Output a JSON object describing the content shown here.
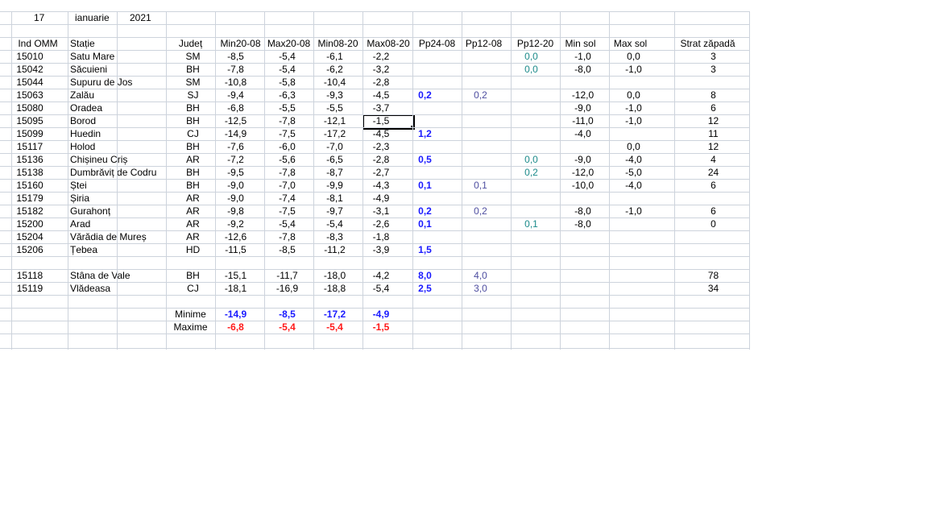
{
  "colors": {
    "blue_bold": "#1a1aff",
    "slate_blue": "#4e4ea0",
    "teal": "#1b8a8a",
    "red": "#ff1a1a",
    "grid": "#cdd3dc"
  },
  "date": {
    "day": "17",
    "month": "ianuarie",
    "year": "2021"
  },
  "headers": {
    "ind": "Ind OMM",
    "statie": "Stație",
    "judet": "Județ",
    "min2008": "Min20-08",
    "max2008": "Max20-08",
    "min0820": "Min08-20",
    "max0820": "Max08-20",
    "pp2408": "Pp24-08",
    "pp1208": "Pp12-08",
    "pp1220": "Pp12-20",
    "minsol": "Min sol",
    "maxsol": "Max sol",
    "strat": "Strat zăpadă"
  },
  "rows": [
    {
      "ind": "15010",
      "statie": "Satu Mare",
      "judet": "SM",
      "min2008": "-8,5",
      "max2008": "-5,4",
      "min0820": "-6,1",
      "max0820": "-2,2",
      "pp2408": "",
      "pp1208": "",
      "pp1220": "0,0",
      "minsol": "-1,0",
      "maxsol": "0,0",
      "strat": "3"
    },
    {
      "ind": "15042",
      "statie": "Săcuieni",
      "judet": "BH",
      "min2008": "-7,8",
      "max2008": "-5,4",
      "min0820": "-6,2",
      "max0820": "-3,2",
      "pp2408": "",
      "pp1208": "",
      "pp1220": "0,0",
      "minsol": "-8,0",
      "maxsol": "-1,0",
      "strat": "3"
    },
    {
      "ind": "15044",
      "statie": "Supuru de Jos",
      "judet": "SM",
      "min2008": "-10,8",
      "max2008": "-5,8",
      "min0820": "-10,4",
      "max0820": "-2,8",
      "pp2408": "",
      "pp1208": "",
      "pp1220": "",
      "minsol": "",
      "maxsol": "",
      "strat": ""
    },
    {
      "ind": "15063",
      "statie": "Zalău",
      "judet": "SJ",
      "min2008": "-9,4",
      "max2008": "-6,3",
      "min0820": "-9,3",
      "max0820": "-4,5",
      "pp2408": "0,2",
      "pp1208": "0,2",
      "pp1220": "",
      "minsol": "-12,0",
      "maxsol": "0,0",
      "strat": "8"
    },
    {
      "ind": "15080",
      "statie": "Oradea",
      "judet": "BH",
      "min2008": "-6,8",
      "max2008": "-5,5",
      "min0820": "-5,5",
      "max0820": "-3,7",
      "pp2408": "",
      "pp1208": "",
      "pp1220": "",
      "minsol": "-9,0",
      "maxsol": "-1,0",
      "strat": "6"
    },
    {
      "ind": "15095",
      "statie": "Borod",
      "judet": "BH",
      "min2008": "-12,5",
      "max2008": "-7,8",
      "min0820": "-12,1",
      "max0820": "-1,5",
      "pp2408": "",
      "pp1208": "",
      "pp1220": "",
      "minsol": "-11,0",
      "maxsol": "-1,0",
      "strat": "12"
    },
    {
      "ind": "15099",
      "statie": "Huedin",
      "judet": "CJ",
      "min2008": "-14,9",
      "max2008": "-7,5",
      "min0820": "-17,2",
      "max0820": "-4,5",
      "pp2408": "1,2",
      "pp1208": "",
      "pp1220": "",
      "minsol": "-4,0",
      "maxsol": "",
      "strat": "11"
    },
    {
      "ind": "15117",
      "statie": "Holod",
      "judet": "BH",
      "min2008": "-7,6",
      "max2008": "-6,0",
      "min0820": "-7,0",
      "max0820": "-2,3",
      "pp2408": "",
      "pp1208": "",
      "pp1220": "",
      "minsol": "",
      "maxsol": "0,0",
      "strat": "12"
    },
    {
      "ind": "15136",
      "statie": "Chișineu   Criș",
      "judet": "AR",
      "min2008": "-7,2",
      "max2008": "-5,6",
      "min0820": "-6,5",
      "max0820": "-2,8",
      "pp2408": "0,5",
      "pp1208": "",
      "pp1220": "0,0",
      "minsol": "-9,0",
      "maxsol": "-4,0",
      "strat": "4"
    },
    {
      "ind": "15138",
      "statie": "Dumbrăviț  de Codru",
      "judet": "BH",
      "min2008": "-9,5",
      "max2008": "-7,8",
      "min0820": "-8,7",
      "max0820": "-2,7",
      "pp2408": "",
      "pp1208": "",
      "pp1220": "0,2",
      "minsol": "-12,0",
      "maxsol": "-5,0",
      "strat": "24"
    },
    {
      "ind": "15160",
      "statie": "Ștei",
      "judet": "BH",
      "min2008": "-9,0",
      "max2008": "-7,0",
      "min0820": "-9,9",
      "max0820": "-4,3",
      "pp2408": "0,1",
      "pp1208": "0,1",
      "pp1220": "",
      "minsol": "-10,0",
      "maxsol": "-4,0",
      "strat": "6"
    },
    {
      "ind": "15179",
      "statie": "Șiria",
      "judet": "AR",
      "min2008": "-9,0",
      "max2008": "-7,4",
      "min0820": "-8,1",
      "max0820": "-4,9",
      "pp2408": "",
      "pp1208": "",
      "pp1220": "",
      "minsol": "",
      "maxsol": "",
      "strat": ""
    },
    {
      "ind": "15182",
      "statie": "Gurahonț",
      "judet": "AR",
      "min2008": "-9,8",
      "max2008": "-7,5",
      "min0820": "-9,7",
      "max0820": "-3,1",
      "pp2408": "0,2",
      "pp1208": "0,2",
      "pp1220": "",
      "minsol": "-8,0",
      "maxsol": "-1,0",
      "strat": "6"
    },
    {
      "ind": "15200",
      "statie": "Arad",
      "judet": "AR",
      "min2008": "-9,2",
      "max2008": "-5,4",
      "min0820": "-5,4",
      "max0820": "-2,6",
      "pp2408": "0,1",
      "pp1208": "",
      "pp1220": "0,1",
      "minsol": "-8,0",
      "maxsol": "",
      "strat": "0"
    },
    {
      "ind": "15204",
      "statie": "Vărădia de Mureș",
      "judet": "AR",
      "min2008": "-12,6",
      "max2008": "-7,8",
      "min0820": "-8,3",
      "max0820": "-1,8",
      "pp2408": "",
      "pp1208": "",
      "pp1220": "",
      "minsol": "",
      "maxsol": "",
      "strat": ""
    },
    {
      "ind": "15206",
      "statie": "Țebea",
      "judet": "HD",
      "min2008": "-11,5",
      "max2008": "-8,5",
      "min0820": "-11,2",
      "max0820": "-3,9",
      "pp2408": "1,5",
      "pp1208": "",
      "pp1220": "",
      "minsol": "",
      "maxsol": "",
      "strat": ""
    },
    null,
    {
      "ind": "15118",
      "statie": "Stâna de Vale",
      "judet": "BH",
      "min2008": "-15,1",
      "max2008": "-11,7",
      "min0820": "-18,0",
      "max0820": "-4,2",
      "pp2408": "8,0",
      "pp1208": "4,0",
      "pp1220": "",
      "minsol": "",
      "maxsol": "",
      "strat": "78"
    },
    {
      "ind": "15119",
      "statie": "Vlădeasa",
      "judet": "CJ",
      "min2008": "-18,1",
      "max2008": "-16,9",
      "min0820": "-18,8",
      "max0820": "-5,4",
      "pp2408": "2,5",
      "pp1208": "3,0",
      "pp1220": "",
      "minsol": "",
      "maxsol": "",
      "strat": "34"
    }
  ],
  "summary": [
    {
      "label": "Minime",
      "min2008": "-14,9",
      "max2008": "-8,5",
      "min0820": "-17,2",
      "max0820": "-4,9",
      "color": "blue"
    },
    {
      "label": "Maxime",
      "min2008": "-6,8",
      "max2008": "-5,4",
      "min0820": "-5,4",
      "max0820": "-1,5",
      "color": "red"
    }
  ]
}
